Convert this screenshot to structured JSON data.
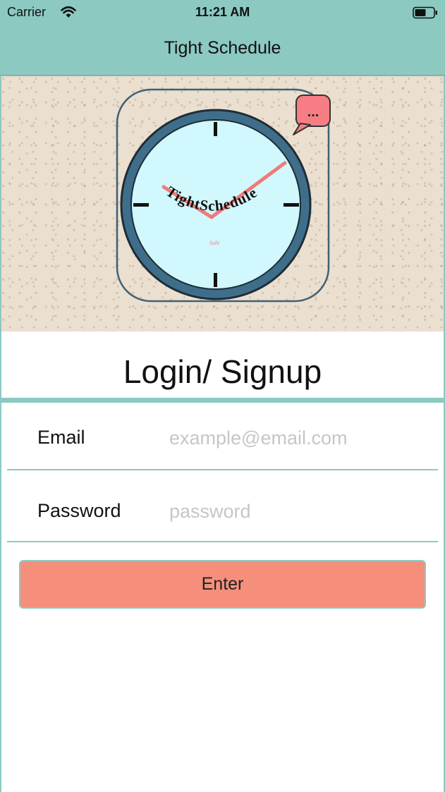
{
  "status_bar": {
    "carrier": "Carrier",
    "time": "11:21 AM",
    "wifi_icon": "wifi-icon",
    "battery_icon": "battery-icon"
  },
  "nav": {
    "title": "Tight Schedule"
  },
  "logo": {
    "icon": "clock-logo-icon",
    "text": "TightSchedule",
    "signature": "Sabi",
    "speech_bubble": "...",
    "colors": {
      "face": "#d0f8fd",
      "rim": "#3f6e8a",
      "hands": "#f07a7a",
      "bubble": "#f57d83"
    }
  },
  "form": {
    "heading": "Login/ Signup",
    "email": {
      "label": "Email",
      "placeholder": "example@email.com",
      "value": ""
    },
    "password": {
      "label": "Password",
      "placeholder": "password",
      "value": ""
    },
    "submit_label": "Enter"
  },
  "colors": {
    "accent": "#8bc9c1",
    "button": "#f58f7c",
    "placeholder": "#c6c6c9"
  }
}
